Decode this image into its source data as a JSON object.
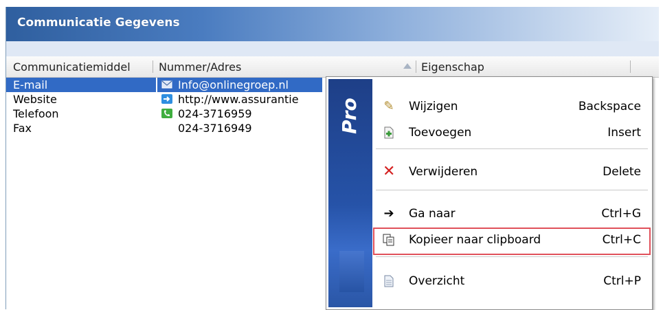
{
  "panel": {
    "title": "Communicatie Gegevens"
  },
  "columns": [
    {
      "label": "Communicatiemiddel"
    },
    {
      "label": "Nummer/Adres"
    },
    {
      "label": "Eigenschap"
    }
  ],
  "rows": [
    {
      "type": "E-mail",
      "value": "Info@onlinegroep.nl",
      "icon": "email-icon",
      "selected": true
    },
    {
      "type": "Website",
      "value": "http://www.assurantie",
      "icon": "web-link-icon",
      "selected": false
    },
    {
      "type": "Telefoon",
      "value": "024-3716959",
      "icon": "phone-icon",
      "selected": false
    },
    {
      "type": "Fax",
      "value": "024-3716949",
      "icon": "",
      "selected": false
    }
  ],
  "context_menu": {
    "brand": "Pro",
    "items": [
      {
        "label": "Wijzigen",
        "shortcut": "Backspace",
        "icon": "pencil-icon"
      },
      {
        "label": "Toevoegen",
        "shortcut": "Insert",
        "icon": "add-document-icon"
      },
      {
        "label": "Verwijderen",
        "shortcut": "Delete",
        "icon": "delete-x-icon"
      },
      {
        "label": "Ga naar",
        "shortcut": "Ctrl+G",
        "icon": "arrow-right-icon"
      },
      {
        "label": "Kopieer naar clipboard",
        "shortcut": "Ctrl+C",
        "icon": "copy-icon",
        "highlighted": true
      },
      {
        "label": "Overzicht",
        "shortcut": "Ctrl+P",
        "icon": "document-icon"
      }
    ]
  },
  "colors": {
    "selection": "#316ac5",
    "highlight_border": "#e0505a",
    "title_bar": "#2f5f9f"
  }
}
